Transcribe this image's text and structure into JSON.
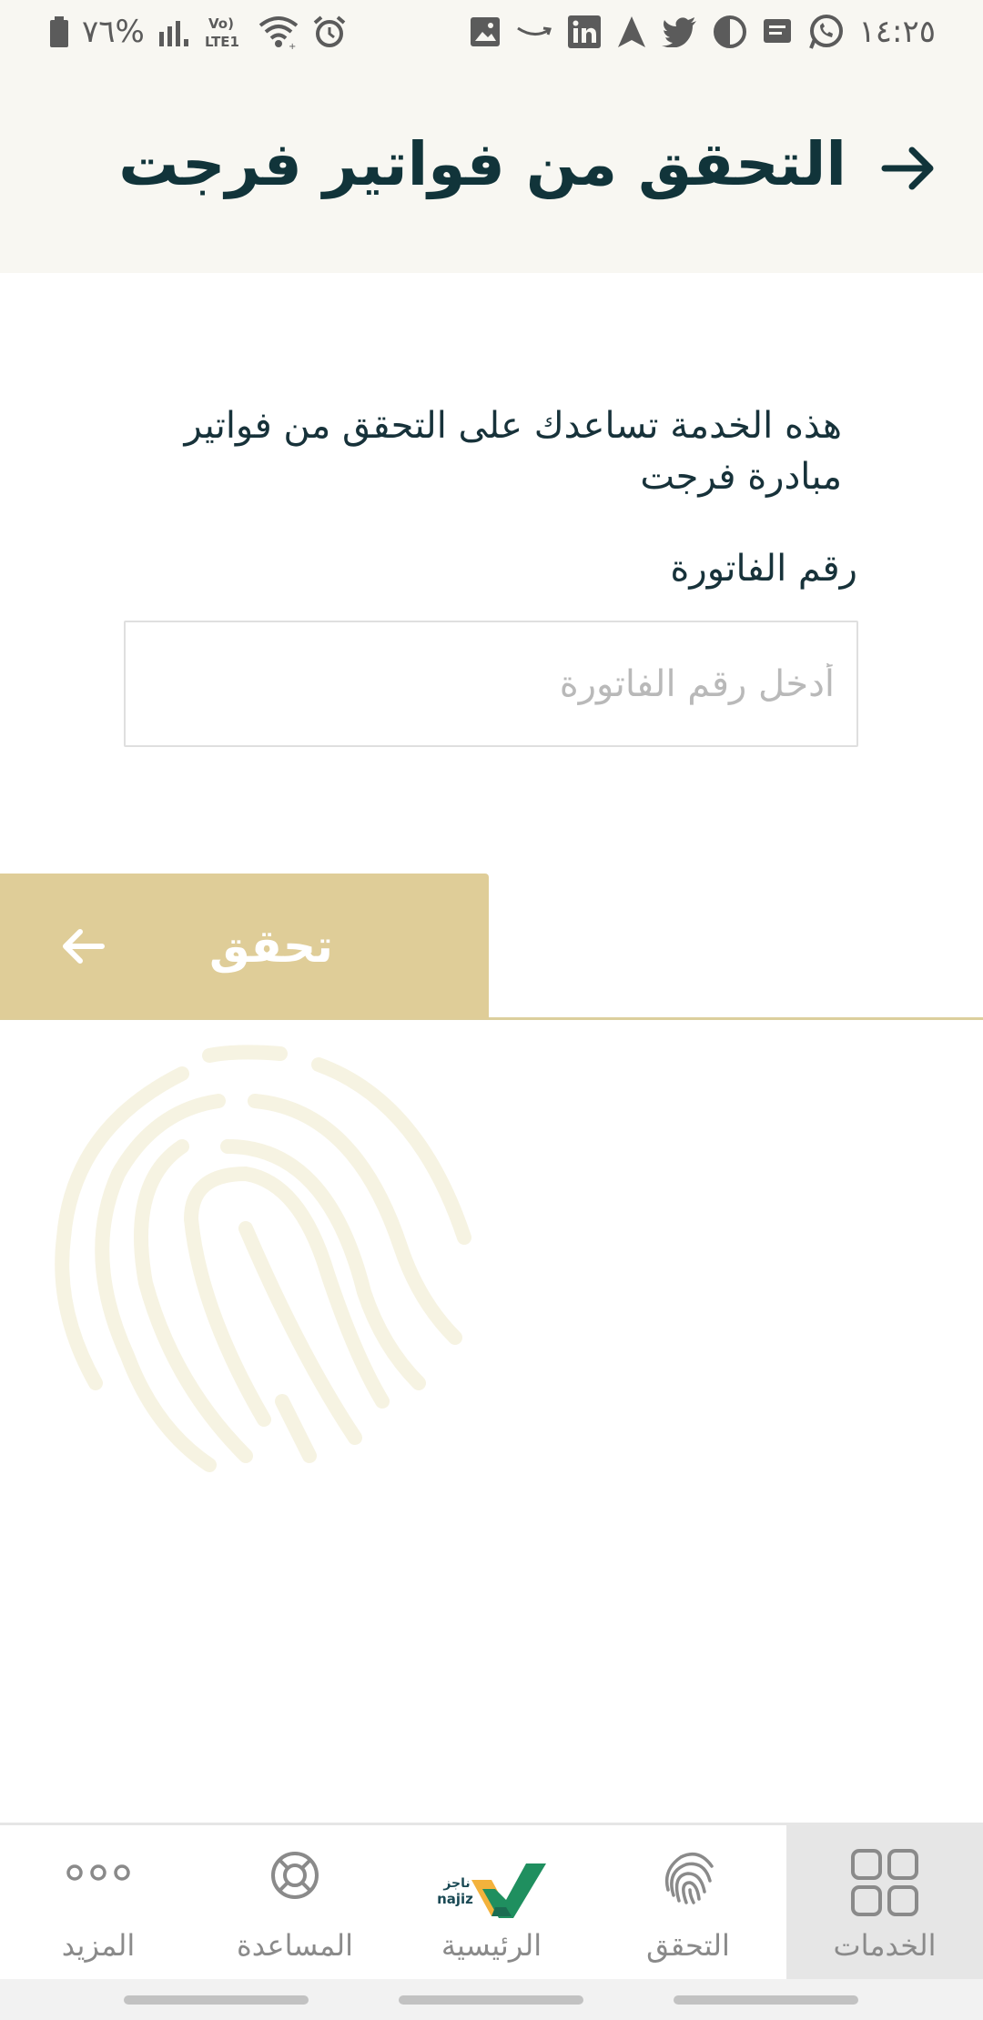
{
  "status_bar": {
    "time": "١٤:٢٥",
    "battery": "٧٦%",
    "network": "Vo) LTE1",
    "icons": [
      "whatsapp-icon",
      "message-icon",
      "night-mode-icon",
      "twitter-icon",
      "navigation-icon",
      "linkedin-icon",
      "amazon-icon",
      "gallery-icon",
      "alarm-icon",
      "wifi-icon",
      "signal-icon",
      "battery-icon"
    ]
  },
  "header": {
    "title": "التحقق من فواتير فرجت",
    "back_icon": "arrow-right-icon",
    "background": "#f8f7f2",
    "title_color": "#11343a"
  },
  "form": {
    "description": "هذه الخدمة تساعدك على التحقق من فواتير مبادرة فرجت",
    "label": "رقم الفاتورة",
    "input_value": "",
    "input_placeholder": "أدخل رقم الفاتورة"
  },
  "action": {
    "verify_label": "تحقق",
    "verify_icon": "arrow-left-icon",
    "button_color": "#dfcd98"
  },
  "decoration": {
    "watermark_icon": "fingerprint-icon"
  },
  "bottom_nav": {
    "items": [
      {
        "label": "الخدمات",
        "icon": "grid-icon",
        "active": true
      },
      {
        "label": "التحقق",
        "icon": "fingerprint-icon",
        "active": false
      },
      {
        "label": "الرئيسية",
        "icon": "najiz-logo",
        "active": false
      },
      {
        "label": "المساعدة",
        "icon": "lifebuoy-icon",
        "active": false
      },
      {
        "label": "المزيد",
        "icon": "more-dots-icon",
        "active": false
      }
    ]
  },
  "logo": {
    "text": "ناجز",
    "latin": "najiz"
  }
}
